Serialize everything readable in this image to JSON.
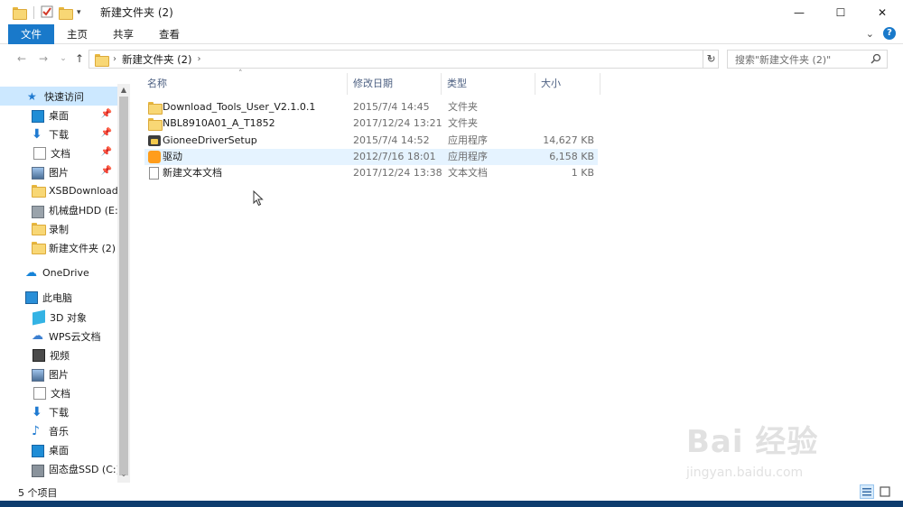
{
  "window": {
    "title": "新建文件夹 (2)",
    "controls": {
      "minimize": "—",
      "maximize": "☐",
      "close": "✕"
    }
  },
  "ribbon": {
    "tabs": [
      "文件",
      "主页",
      "共享",
      "查看"
    ],
    "expand": "⌄",
    "help": "?"
  },
  "nav": {
    "back": "←",
    "forward": "→",
    "recent": "⌄",
    "up": "↑",
    "breadcrumb": "新建文件夹 (2)",
    "breadcrumb_sep": "›",
    "refresh": "↻",
    "search_placeholder": "搜索\"新建文件夹 (2)\""
  },
  "sidebar": {
    "quick_access": "快速访问",
    "items": [
      {
        "label": "桌面",
        "icon": "desktop-icon",
        "pinned": true
      },
      {
        "label": "下载",
        "icon": "download-icon",
        "pinned": true
      },
      {
        "label": "文档",
        "icon": "document-icon",
        "pinned": true
      },
      {
        "label": "图片",
        "icon": "pictures-icon",
        "pinned": true
      },
      {
        "label": "XSBDownload",
        "icon": "folder-icon",
        "pinned": false
      },
      {
        "label": "机械盘HDD (E:)",
        "icon": "drive-icon",
        "pinned": false
      },
      {
        "label": "录制",
        "icon": "folder-icon",
        "pinned": false
      },
      {
        "label": "新建文件夹 (2)",
        "icon": "folder-icon",
        "pinned": false
      }
    ],
    "onedrive": "OneDrive",
    "this_pc": "此电脑",
    "pc_items": [
      {
        "label": "3D 对象",
        "icon": "3d-objects-icon"
      },
      {
        "label": "WPS云文档",
        "icon": "cloud-icon"
      },
      {
        "label": "视频",
        "icon": "video-icon"
      },
      {
        "label": "图片",
        "icon": "pictures-icon"
      },
      {
        "label": "文档",
        "icon": "document-icon"
      },
      {
        "label": "下载",
        "icon": "download-icon"
      },
      {
        "label": "音乐",
        "icon": "music-icon"
      },
      {
        "label": "桌面",
        "icon": "desktop-icon"
      },
      {
        "label": "固态盘SSD (C:)",
        "icon": "ssd-icon"
      }
    ]
  },
  "filelist": {
    "columns": {
      "name": "名称",
      "date": "修改日期",
      "type": "类型",
      "size": "大小"
    },
    "rows": [
      {
        "name": "Download_Tools_User_V2.1.0.1",
        "date": "2015/7/4 14:45",
        "type": "文件夹",
        "size": "",
        "icon": "folder-icon"
      },
      {
        "name": "NBL8910A01_A_T1852",
        "date": "2017/12/24 13:21",
        "type": "文件夹",
        "size": "",
        "icon": "folder-icon"
      },
      {
        "name": "GioneeDriverSetup",
        "date": "2015/7/4 14:52",
        "type": "应用程序",
        "size": "14,627 KB",
        "icon": "app-icon"
      },
      {
        "name": "驱动",
        "date": "2012/7/16 18:01",
        "type": "应用程序",
        "size": "6,158 KB",
        "icon": "driver-app-icon"
      },
      {
        "name": "新建文本文档",
        "date": "2017/12/24 13:38",
        "type": "文本文档",
        "size": "1 KB",
        "icon": "text-file-icon"
      }
    ]
  },
  "status": {
    "item_count": "5 个项目"
  },
  "watermark": {
    "brand": "Bai 经验",
    "url": "jingyan.baidu.com"
  }
}
